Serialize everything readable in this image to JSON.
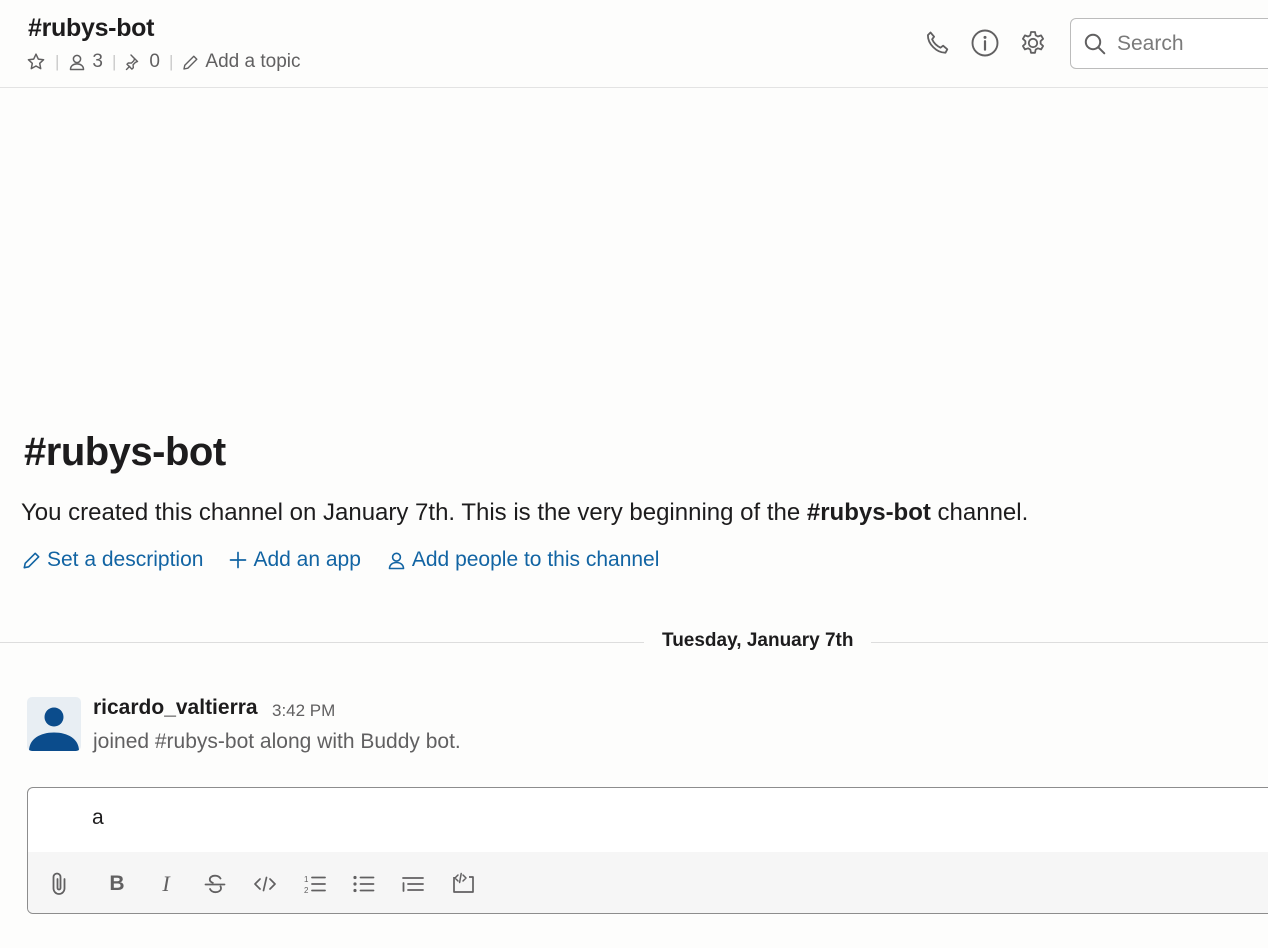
{
  "header": {
    "channel_name": "#rubys-bot",
    "member_count": "3",
    "pinned_count": "0",
    "add_topic_label": "Add a topic",
    "search_placeholder": "Search"
  },
  "intro": {
    "title": "#rubys-bot",
    "text_before": "You created this channel on January 7th. This is the very beginning of the ",
    "channel_ref": "#rubys-bot",
    "text_after": " channel.",
    "actions": {
      "set_description": "Set a description",
      "add_app": "Add an app",
      "add_people": "Add people to this channel"
    }
  },
  "divider": {
    "date": "Tuesday, January 7th"
  },
  "message": {
    "author": "ricardo_valtierra",
    "time": "3:42 PM",
    "text": "joined #rubys-bot along with Buddy bot."
  },
  "composer": {
    "value": "a",
    "toolbar": {
      "bold": "B",
      "italic": "I"
    }
  },
  "colors": {
    "link": "#1264a3",
    "avatar": "#0b4c8c",
    "text": "#1d1c1d",
    "muted": "#616061"
  },
  "icons": [
    "star-icon",
    "member-icon",
    "pin-icon",
    "pencil-icon",
    "phone-icon",
    "info-icon",
    "gear-icon",
    "search-icon",
    "plus-icon",
    "person-icon",
    "paperclip-icon",
    "strikethrough-icon",
    "code-icon",
    "ordered-list-icon",
    "bulleted-list-icon",
    "blockquote-icon",
    "code-block-icon"
  ]
}
